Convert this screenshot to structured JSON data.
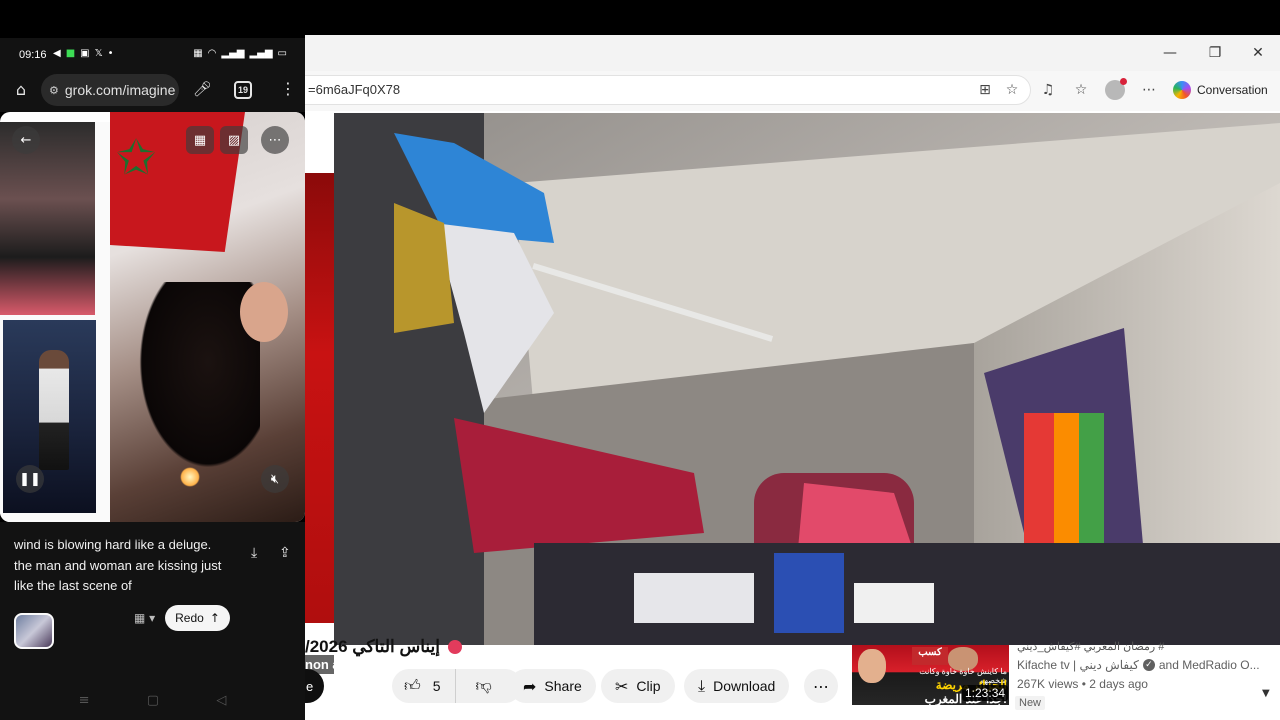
{
  "browser": {
    "url_fragment": "=6m6aJFq0X78",
    "copilot_label": "Conversation",
    "window_controls": {
      "minimize": "—",
      "maximize": "❐",
      "close": "✕"
    }
  },
  "youtube": {
    "video_title": "/2026 ⁦إيناس التاكي⁩",
    "side_thumb_caption": "non a",
    "subscribe_stub": "e",
    "actions": {
      "like_count": "5",
      "share": "Share",
      "clip": "Clip",
      "download": "Download"
    },
    "recommendation": {
      "top_title": "رمضان المغربي #كيفاش_ديني #",
      "channel": "Kifache tv | كيفاش ديني",
      "channel_suffix": "and MedRadio O...",
      "views": "267K views",
      "age": "2 days ago",
      "badge": "New",
      "duration": "1:23:34",
      "thumb_head": "كسب",
      "thumb_line1": "ما كاينش خاوة خاوة وكانت شخصهم",
      "thumb_line2": "الجزائر مريضة",
      "thumb_line3": "جدا عند المغرب!"
    }
  },
  "phone": {
    "time": "09:16",
    "url": "grok.com/imagine",
    "tabs_count": "19",
    "prompt_text": "wind is blowing hard like a deluge. the man and woman are kissing just like the last scene of",
    "redo_label": "Redo"
  }
}
